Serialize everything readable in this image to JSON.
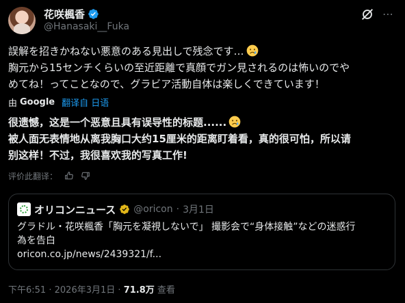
{
  "author": {
    "display_name": "花咲楓香",
    "handle": "@Hanasaki__Fuka",
    "verified_color": "#1d9bf0"
  },
  "post": {
    "text_lines": [
      "誤解を招きかねない悪意のある見出しで残念です…",
      "胸元から15センチくらいの至近距離で真顔でガン見されるのは怖いのでや",
      "めてね！ってことなので、グラビア活動自体は楽しくできています！"
    ],
    "translation": {
      "by": "由",
      "provider": "Google",
      "link": "翻译自 日语"
    },
    "translated_lines": [
      "很遗憾，这是一个恶意且具有误导性的标题......",
      "被人面无表情地从离我胸口大约15厘米的距离盯着看，真的很可怕，所以请",
      "别这样！不过，我很喜欢我的写真工作!"
    ],
    "rate_label": "评价此翻译："
  },
  "quote": {
    "name": "オリコンニュース",
    "handle": "@oricon",
    "separator": "·",
    "date": "3月1日",
    "text_lines": [
      "グラドル・花咲楓香「胸元を凝視しないで」 撮影会で“身体接触”などの迷惑行",
      "為を告白",
      "oricon.co.jp/news/2439321/f..."
    ],
    "gold_badge_color": "#e2b719"
  },
  "meta": {
    "time": "下午6:51",
    "dot": "·",
    "date": "2026年3月1日",
    "views": "71.8万",
    "views_label": "查看"
  },
  "icons": {
    "more": "more-icon",
    "grok": "grok-icon",
    "thumbs_up": "thumbs-up-icon",
    "thumbs_down": "thumbs-down-icon",
    "emoji": "crying-face-emoji"
  }
}
